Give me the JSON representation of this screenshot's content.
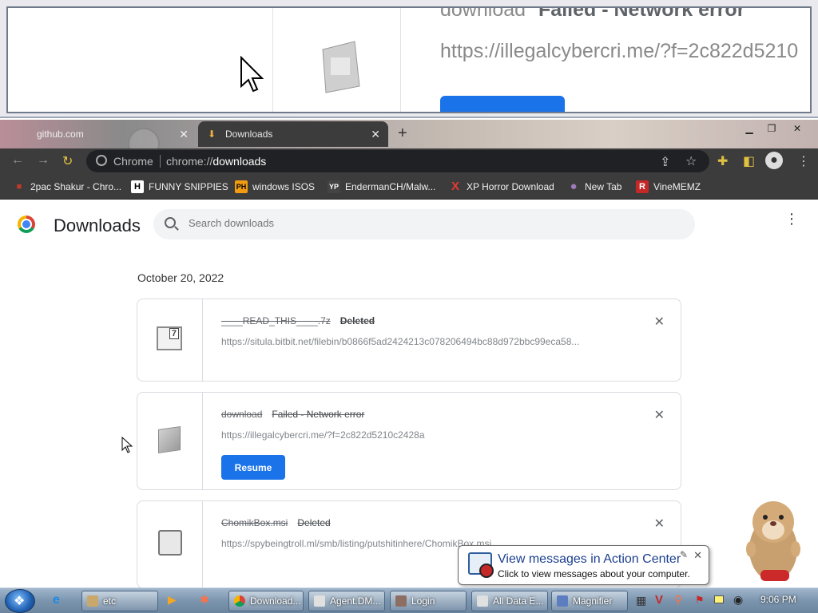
{
  "magnifier": {
    "title_file": "download",
    "title_status": "Failed - Network error",
    "url": "https://illegalcybercri.me/?f=2c822d5210"
  },
  "tabs": [
    {
      "label": "github.com"
    },
    {
      "label": "Downloads"
    }
  ],
  "omnibox": {
    "chip": "Chrome",
    "url_prefix": "chrome://",
    "url_path": "downloads"
  },
  "bookmarks": [
    {
      "label": "2pac Shakur - Chro...",
      "icon": "briefcase-icon",
      "color": "#c0392b",
      "glyph": "■"
    },
    {
      "label": "FUNNY SNIPPIES",
      "icon": "h-icon",
      "color": "#ffffff",
      "glyph": "H"
    },
    {
      "label": "windows ISOS",
      "icon": "ph-icon",
      "color": "#f39c12",
      "glyph": "PH"
    },
    {
      "label": "EndermanCH/Malw...",
      "icon": "yp-icon",
      "color": "#444444",
      "glyph": "YP"
    },
    {
      "label": "XP Horror Download",
      "icon": "x-icon",
      "color": "#e53935",
      "glyph": "X"
    },
    {
      "label": "New Tab",
      "icon": "globe-icon",
      "color": "#9c7bb8",
      "glyph": "●"
    },
    {
      "label": "VineMEMZ",
      "icon": "vine-icon",
      "color": "#c62828",
      "glyph": "R"
    }
  ],
  "page": {
    "title": "Downloads",
    "search_placeholder": "Search downloads",
    "date": "October 20, 2022"
  },
  "downloads": [
    {
      "file": "____READ_THIS____.7z",
      "status": "Deleted",
      "url": "https://situla.bitbit.net/filebin/b0866f5ad2424213c078206494bc88d972bbc99eca58..."
    },
    {
      "file": "download",
      "status": "Failed - Network error",
      "url": "https://illegalcybercri.me/?f=2c822d5210c2428a",
      "button": "Resume"
    },
    {
      "file": "ChomikBox.msi",
      "status": "Deleted",
      "url": "https://spybeingtroll.ml/smb/listing/putshitinhere/ChomikBox.msi"
    }
  ],
  "balloon": {
    "title": "View messages in Action Center",
    "text": "Click to view messages about your computer."
  },
  "taskbar": {
    "items": [
      {
        "label": "etc"
      },
      {
        "label": "Download..."
      },
      {
        "label": "Agent.DM..."
      },
      {
        "label": "Login"
      },
      {
        "label": "All Data E..."
      },
      {
        "label": "Magnifier"
      }
    ],
    "clock": "9:06 PM"
  }
}
